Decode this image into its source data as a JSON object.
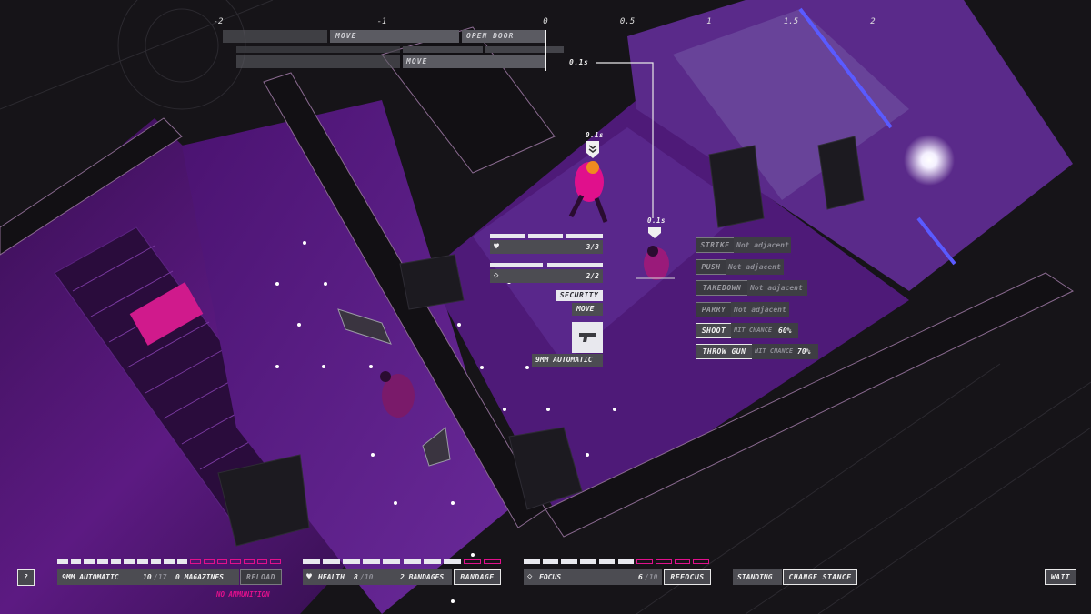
{
  "timeline": {
    "ticks": [
      "-2",
      "-1",
      "0",
      "0.5",
      "1",
      "1.5",
      "2"
    ],
    "row1": [
      "MOVE",
      "OPEN DOOR"
    ],
    "row3": [
      "MOVE"
    ],
    "time_marker": "0.1s"
  },
  "enemy_markers": [
    {
      "label": "0.1s"
    },
    {
      "label": "0.1s"
    }
  ],
  "target_info": {
    "health_value": "3/3",
    "armor_value": "2/2",
    "faction": "SECURITY",
    "action": "MOVE",
    "weapon": "9MM AUTOMATIC",
    "heart_icon": "heart-icon",
    "armor_icon": "diamond-icon",
    "weapon_icon": "pistol-icon"
  },
  "actions": [
    {
      "label": "STRIKE",
      "status": "Not adjacent",
      "enabled": false
    },
    {
      "label": "PUSH",
      "status": "Not adjacent",
      "enabled": false
    },
    {
      "label": "TAKEDOWN",
      "status": "Not adjacent",
      "enabled": false
    },
    {
      "label": "PARRY",
      "status": "Not adjacent",
      "enabled": false
    },
    {
      "label": "SHOOT",
      "status": "HIT CHANCE",
      "chance": "60%",
      "enabled": true
    },
    {
      "label": "THROW GUN",
      "status": "HIT CHANCE",
      "chance": "70%",
      "enabled": true
    }
  ],
  "hud": {
    "help_button": "?",
    "weapon": {
      "name": "9MM AUTOMATIC",
      "ammo": "10",
      "ammo_max": "/17",
      "magazines": "0 MAGAZINES",
      "reload": "RELOAD",
      "warning": "NO AMMUNITION",
      "pips_filled": 10,
      "pips_total": 17
    },
    "health": {
      "label": "HEALTH",
      "value": "8",
      "max": "/10",
      "bandages": "2 BANDAGES",
      "bandage_button": "BANDAGE",
      "pips_filled": 8,
      "pips_total": 10
    },
    "focus": {
      "label": "FOCUS",
      "value": "6",
      "max": "/10",
      "refocus_button": "REFOCUS",
      "pips_filled": 6,
      "pips_total": 10
    },
    "stance": {
      "label": "STANDING",
      "button": "CHANGE STANCE"
    },
    "wait_button": "WAIT"
  },
  "colors": {
    "accent_pink": "#e0108c",
    "floor_purple": "#5a1a7a",
    "hud_white": "#e8e8ee"
  }
}
